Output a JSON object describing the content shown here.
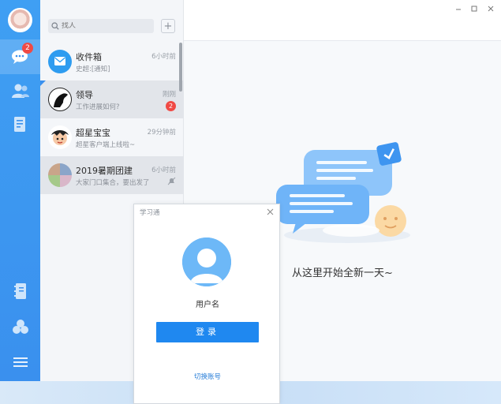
{
  "rail": {
    "badge": "2",
    "accent": "#3a90ee"
  },
  "search": {
    "placeholder": "找人",
    "add_symbol": "+"
  },
  "conversations": [
    {
      "title": "收件箱",
      "subtitle": "史超:[通知]",
      "time": "6小时前",
      "badge": ""
    },
    {
      "title": "领导",
      "subtitle": "工作进展如何?",
      "time": "刚刚",
      "badge": "2"
    },
    {
      "title": "超星宝宝",
      "subtitle": "超星客户端上线啦~",
      "time": "29分钟前",
      "badge": ""
    },
    {
      "title": "2019暑期团建",
      "subtitle": "大家门口集合，要出发了",
      "time": "6小时前",
      "badge": ""
    }
  ],
  "main": {
    "welcome": "从这里开始全新一天~"
  },
  "dialog": {
    "title": "学习通",
    "username": "用户名",
    "login_label": "登录",
    "switch_label": "切换账号"
  }
}
